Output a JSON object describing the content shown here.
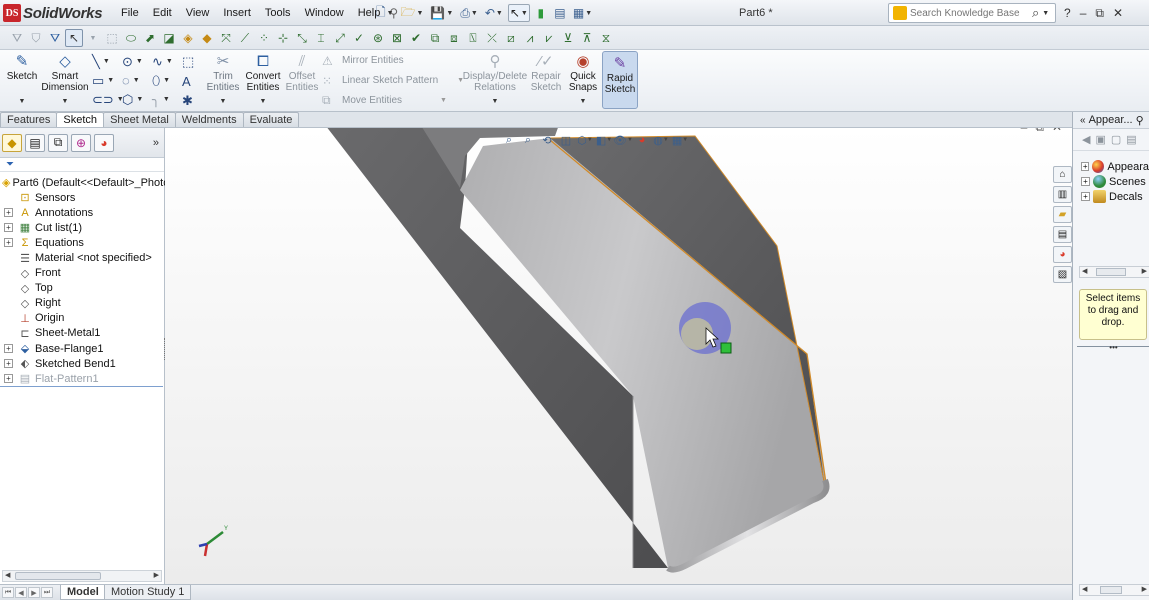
{
  "app": {
    "brand": "SolidWorks",
    "brand_mark": "DS",
    "document_title": "Part6 *"
  },
  "menu": {
    "items": [
      "File",
      "Edit",
      "View",
      "Insert",
      "Tools",
      "Window",
      "Help"
    ]
  },
  "search": {
    "placeholder": "Search Knowledge Base"
  },
  "window_controls": {
    "help": "?",
    "minimize": "–",
    "restore": "⧉",
    "close": "✕"
  },
  "command_manager": {
    "sketch": "Sketch",
    "smart_dimension_1": "Smart",
    "smart_dimension_2": "Dimension",
    "trim_1": "Trim",
    "trim_2": "Entities",
    "convert_1": "Convert",
    "convert_2": "Entities",
    "offset_1": "Offset",
    "offset_2": "Entities",
    "mirror": "Mirror Entities",
    "linear_pattern": "Linear Sketch Pattern",
    "move": "Move Entities",
    "display_delete_1": "Display/Delete",
    "display_delete_2": "Relations",
    "repair_1": "Repair",
    "repair_2": "Sketch",
    "quick_snaps_1": "Quick",
    "quick_snaps_2": "Snaps",
    "rapid_sketch_1": "Rapid",
    "rapid_sketch_2": "Sketch"
  },
  "tabs": [
    {
      "label": "Features",
      "active": false
    },
    {
      "label": "Sketch",
      "active": true
    },
    {
      "label": "Sheet Metal",
      "active": false
    },
    {
      "label": "Weldments",
      "active": false
    },
    {
      "label": "Evaluate",
      "active": false
    }
  ],
  "feature_tree": {
    "root": "Part6  (Default<<Default>_Photo",
    "items": [
      {
        "label": "Sensors",
        "icon": "sensor-icon",
        "expandable": false
      },
      {
        "label": "Annotations",
        "icon": "annotations-icon",
        "expandable": true
      },
      {
        "label": "Cut list(1)",
        "icon": "cut-list-icon",
        "expandable": true
      },
      {
        "label": "Equations",
        "icon": "equations-icon",
        "expandable": true
      },
      {
        "label": "Material <not specified>",
        "icon": "material-icon",
        "expandable": false
      },
      {
        "label": "Front",
        "icon": "plane-icon",
        "expandable": false
      },
      {
        "label": "Top",
        "icon": "plane-icon",
        "expandable": false
      },
      {
        "label": "Right",
        "icon": "plane-icon",
        "expandable": false
      },
      {
        "label": "Origin",
        "icon": "origin-icon",
        "expandable": false
      },
      {
        "label": "Sheet-Metal1",
        "icon": "sheet-metal-icon",
        "expandable": false
      },
      {
        "label": "Base-Flange1",
        "icon": "base-flange-icon",
        "expandable": true
      },
      {
        "label": "Sketched Bend1",
        "icon": "sketched-bend-icon",
        "expandable": true
      },
      {
        "label": "Flat-Pattern1",
        "icon": "flat-pattern-icon",
        "expandable": true,
        "suppressed": true
      }
    ]
  },
  "bottom_tabs": [
    {
      "label": "Model",
      "active": true
    },
    {
      "label": "Motion Study 1",
      "active": false
    }
  ],
  "task_pane": {
    "title": "Appear...",
    "items": [
      {
        "label": "Appeara",
        "color": "#d93b2b"
      },
      {
        "label": "Scenes",
        "color": "#2f8a3a"
      },
      {
        "label": "Decals",
        "color": "#d2a12b"
      }
    ],
    "tooltip": "Select items to drag and drop."
  },
  "colors": {
    "part_dark": "#5a5a5c",
    "part_light": "#bdbdbf",
    "edge_highlight": "#d08a2a",
    "accent": "#2d5fa0"
  }
}
